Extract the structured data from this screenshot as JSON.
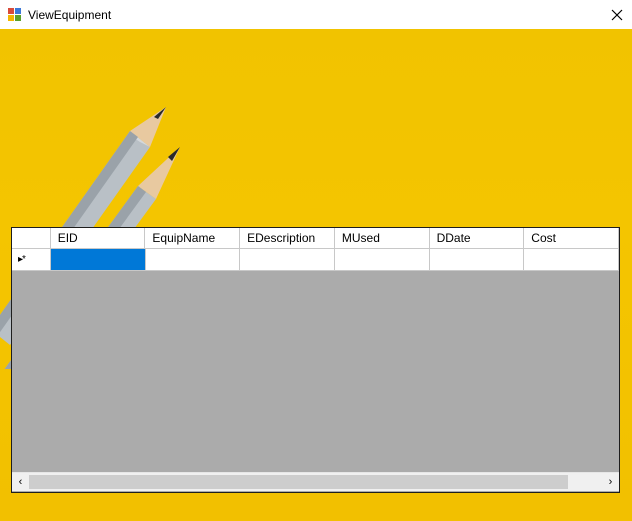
{
  "window": {
    "title": "ViewEquipment",
    "close_icon": "close-icon",
    "app_icon": "form-icon"
  },
  "grid": {
    "columns": [
      "EID",
      "EquipName",
      "EDescription",
      "MUsed",
      "DDate",
      "Cost"
    ],
    "new_row_marker": "▸*",
    "rows": [
      {
        "cells": [
          "",
          "",
          "",
          "",
          "",
          ""
        ],
        "selected_column": "EID",
        "is_new_row": true
      }
    ],
    "scroll": {
      "left_arrow": "‹",
      "right_arrow": "›",
      "thumb_fraction": 0.94
    }
  },
  "colors": {
    "background": "#f3c200",
    "grid_background": "#ababab",
    "selection": "#0078d7"
  }
}
